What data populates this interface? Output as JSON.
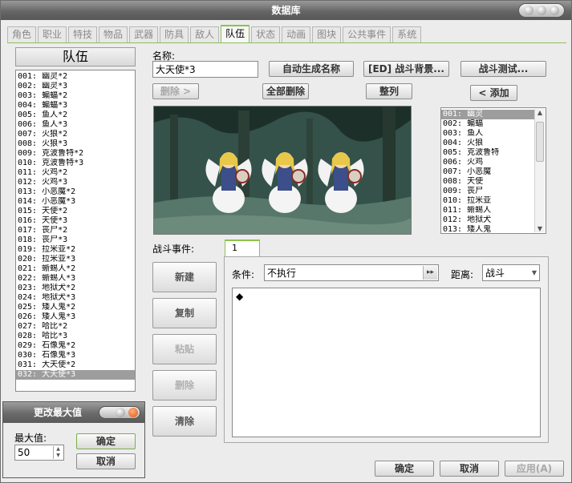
{
  "window": {
    "title": "数据库"
  },
  "tabs": [
    "角色",
    "职业",
    "特技",
    "物品",
    "武器",
    "防具",
    "敌人",
    "队伍",
    "状态",
    "动画",
    "图块",
    "公共事件",
    "系统"
  ],
  "troop_list": {
    "header": "队伍",
    "items": [
      "001: 幽灵*2",
      "002: 幽灵*3",
      "003: 蝙蝠*2",
      "004: 蝙蝠*3",
      "005: 鱼人*2",
      "006: 鱼人*3",
      "007: 火狼*2",
      "008: 火狼*3",
      "009: 克波鲁特*2",
      "010: 克波鲁特*3",
      "011: 火鸡*2",
      "012: 火鸡*3",
      "013: 小恶魔*2",
      "014: 小恶魔*3",
      "015: 天使*2",
      "016: 天使*3",
      "017: 丧尸*2",
      "018: 丧尸*3",
      "019: 拉米亚*2",
      "020: 拉米亚*3",
      "021: 蜥蜴人*2",
      "022: 蜥蜴人*3",
      "023: 地狱犬*2",
      "024: 地狱犬*3",
      "025: 矮人鬼*2",
      "026: 矮人鬼*3",
      "027: 哈比*2",
      "028: 哈比*3",
      "029: 石像鬼*2",
      "030: 石像鬼*3",
      "031: 大天使*2",
      "032: 大天使*3"
    ],
    "selected_index": 31
  },
  "name": {
    "label": "名称:",
    "value": "大天使*3"
  },
  "toolbar": {
    "auto_name": "自动生成名称",
    "battle_bg": "[ED] 战斗背景...",
    "battle_test": "战斗测试...",
    "remove": "删除 >",
    "remove_all": "全部删除",
    "arrange": "整列",
    "add": "< 添加"
  },
  "enemy_list": {
    "items": [
      "001: 幽灵",
      "002: 蝙蝠",
      "003: 鱼人",
      "004: 火狼",
      "005: 克波鲁特",
      "006: 火鸡",
      "007: 小恶魔",
      "008: 天使",
      "009: 丧尸",
      "010: 拉米亚",
      "011: 蜥蜴人",
      "012: 地狱犬",
      "013: 矮人鬼"
    ],
    "selected_index": 0
  },
  "battle_event": {
    "label": "战斗事件:",
    "page_tab": "1",
    "buttons": {
      "new": "新建",
      "copy": "复制",
      "paste": "粘贴",
      "delete": "删除",
      "clear": "清除"
    },
    "condition_label": "条件:",
    "condition_value": "不执行",
    "span_label": "距离:",
    "span_value": "战斗",
    "commands": [
      "◆"
    ]
  },
  "footer": {
    "ok": "确定",
    "cancel": "取消",
    "apply": "应用(A)"
  },
  "max_dialog": {
    "title": "更改最大值",
    "label": "最大值:",
    "value": "50",
    "ok": "确定",
    "cancel": "取消"
  },
  "icons": [
    "scroll-up-icon",
    "scroll-down-icon",
    "dropdown-arrow-icon",
    "ellipsis-icon",
    "window-control-icon"
  ]
}
